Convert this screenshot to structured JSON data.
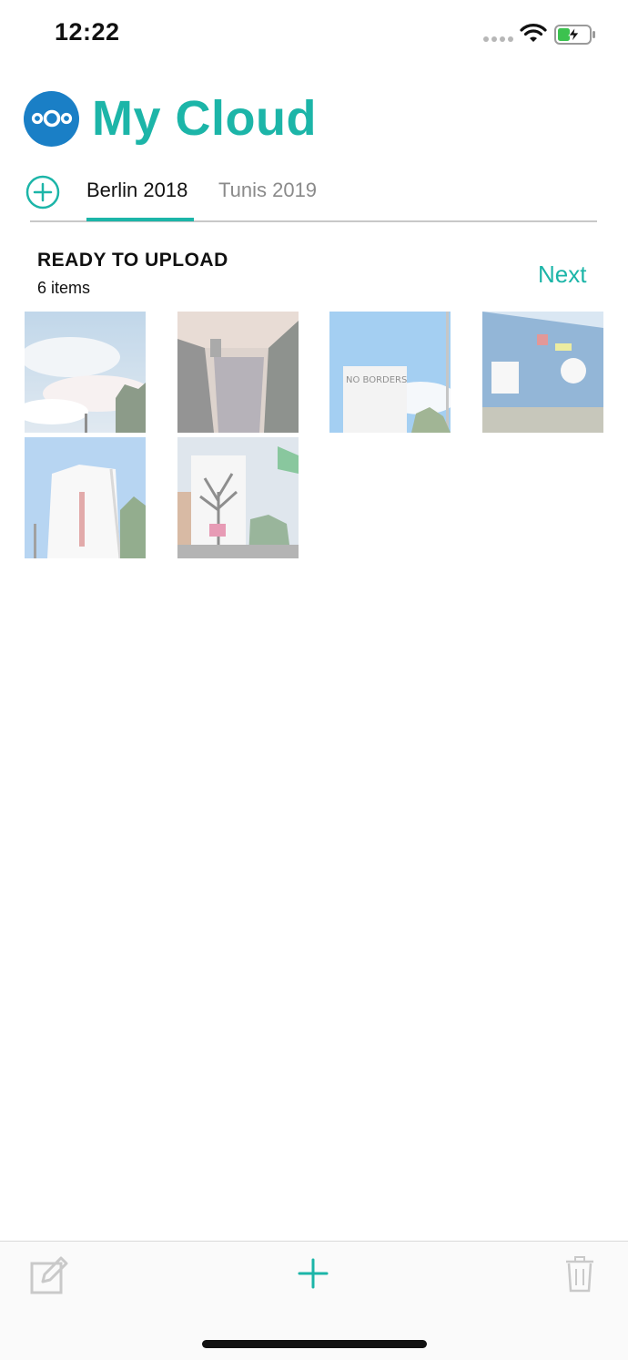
{
  "status_bar": {
    "time": "12:22"
  },
  "header": {
    "title": "My Cloud"
  },
  "tabs": [
    {
      "label": "Berlin 2018",
      "active": true
    },
    {
      "label": "Tunis 2019",
      "active": false
    }
  ],
  "section": {
    "title": "READY TO UPLOAD",
    "count": "6 items",
    "next_label": "Next"
  },
  "photos": [
    {
      "name": "sky-clouds"
    },
    {
      "name": "canal-sunset"
    },
    {
      "name": "building-no-borders"
    },
    {
      "name": "graffiti-wall"
    },
    {
      "name": "tall-building"
    },
    {
      "name": "tree-mural-building"
    }
  ],
  "colors": {
    "accent": "#1cb5a8",
    "logo_blue": "#1a7fc6"
  }
}
